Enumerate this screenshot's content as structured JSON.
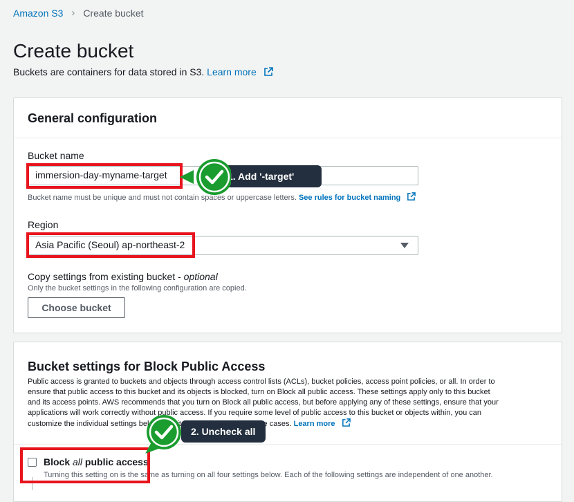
{
  "breadcrumb": {
    "root": "Amazon S3",
    "current": "Create bucket"
  },
  "page": {
    "title": "Create bucket",
    "description": "Buckets are containers for data stored in S3.",
    "learn_more": "Learn more"
  },
  "general": {
    "header": "General configuration",
    "bucket_name_label": "Bucket name",
    "bucket_name_value": "immersion-day-myname-target",
    "bucket_name_hint": "Bucket name must be unique and must not contain spaces or uppercase letters.",
    "bucket_rules_link": "See rules for bucket naming",
    "region_label": "Region",
    "region_value": "Asia Pacific (Seoul) ap-northeast-2",
    "copy_label": "Copy settings from existing bucket - ",
    "copy_optional": "optional",
    "copy_hint": "Only the bucket settings in the following configuration are copied.",
    "choose_bucket": "Choose bucket"
  },
  "annotations": {
    "step1": "1. Add '-target'",
    "step2": "2. Uncheck all",
    "badge_color": "#1a9c2f",
    "highlight_color": "#e8141d"
  },
  "block_public": {
    "header": "Bucket settings for Block Public Access",
    "para_lines": [
      "Public access is granted to buckets and objects through access control lists (ACLs), bucket policies, access point policies, or all. In order to",
      "ensure that public access to this bucket and its objects is blocked, turn on Block all public access. These settings apply only to this bucket",
      "and its access points. AWS recommends that you turn on Block all public access, but before applying any of these settings, ensure that your",
      "applications will work correctly without public access. If you require some level of public access to this bucket or objects within, you can",
      "customize the individual settings below to suit your specific storage use cases."
    ],
    "learn_more": "Learn more",
    "block_all_prefix": "Block ",
    "block_all_em": "all",
    "block_all_suffix": " public access",
    "block_all_desc": "Turning this setting on is the same as turning on all four settings below. Each of the following settings are independent of one another."
  }
}
